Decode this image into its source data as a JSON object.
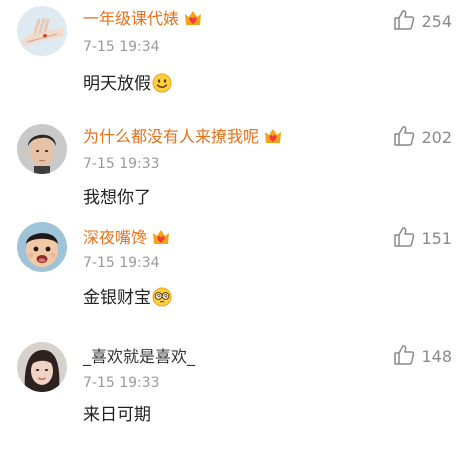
{
  "comments": [
    {
      "username": "一年级课代婊",
      "time": "7-15 19:34",
      "text": "明天放假",
      "likes": "254",
      "has_vip_badge": true,
      "name_color": "#e8711a",
      "emoji": "smile-emoji"
    },
    {
      "username": "为什么都没有人来撩我呢",
      "time": "7-15 19:33",
      "text": "我想你了",
      "likes": "202",
      "has_vip_badge": true,
      "name_color": "#e8711a"
    },
    {
      "username": "深夜嘴馋",
      "time": "7-15 19:34",
      "text": "金银财宝",
      "likes": "151",
      "has_vip_badge": true,
      "name_color": "#e8711a",
      "emoji": "dizzy-eyes-emoji"
    },
    {
      "username": "_喜欢就是喜欢_",
      "time": "7-15 19:33",
      "text": "来日可期",
      "likes": "148",
      "has_vip_badge": false,
      "name_color": "#333333"
    }
  ],
  "icons": {
    "like": "thumbs-up-icon",
    "vip": "crown-heart-badge-icon"
  }
}
